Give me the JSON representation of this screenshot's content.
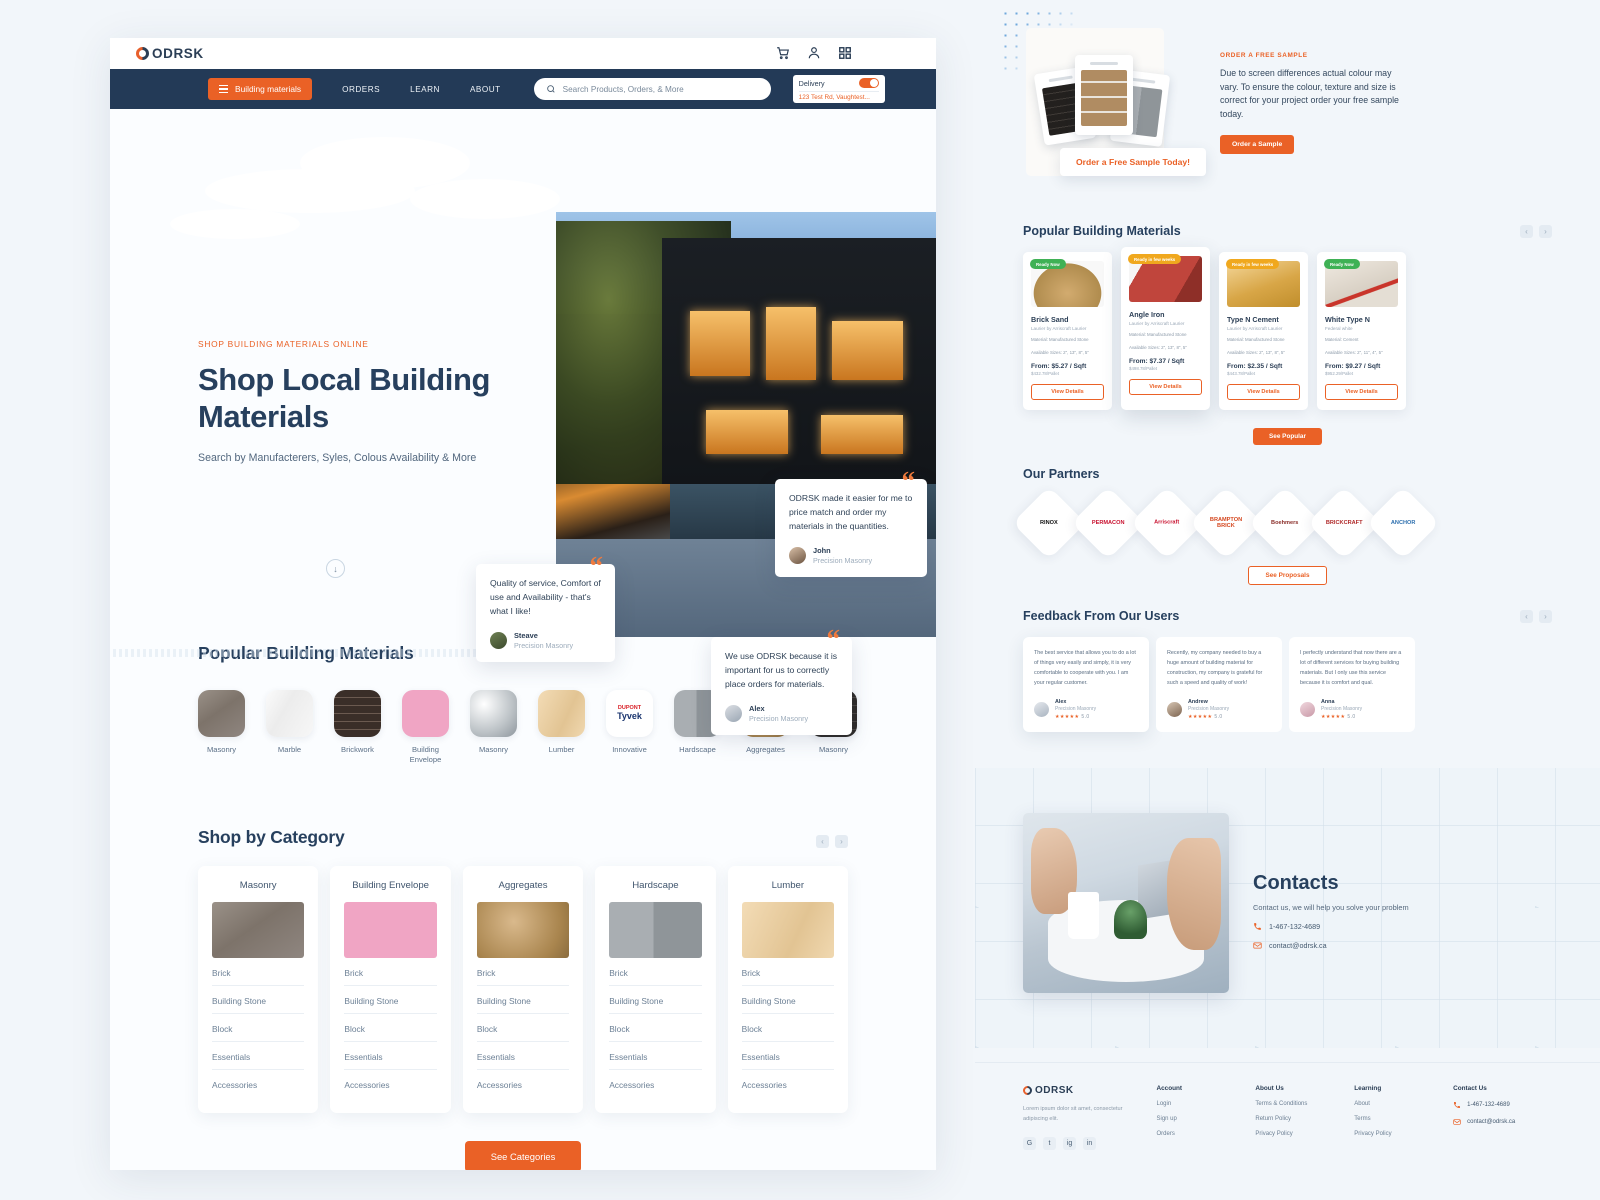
{
  "brand": {
    "name": "ODRSK"
  },
  "topbar": {
    "icons": [
      "cart-icon",
      "user-icon",
      "grid-icon"
    ]
  },
  "nav": {
    "category_button": "Building materials",
    "links": [
      "ORDERS",
      "LEARN",
      "ABOUT"
    ],
    "search_placeholder": "Search Products, Orders, & More",
    "delivery_label": "Delivery",
    "delivery_address": "123 Test Rd, Vaughtest...",
    "delivery_toggle_on": true
  },
  "hero": {
    "eyebrow": "SHOP BUILDING MATERIALS ONLINE",
    "title": "Shop Local Building Materials",
    "subtitle": "Search by Manufacterers, Syles, Colous Availability & More",
    "scroll_icon": "↓",
    "testimonials": [
      {
        "id": "steave",
        "text": "Quality of service, Comfort of use and Availability - that's what I like!",
        "name": "Steave",
        "company": "Precision Masonry"
      },
      {
        "id": "john",
        "text": "ODRSK made it easier for me to price match and order my materials in the quantities.",
        "name": "John",
        "company": "Precision Masonry"
      },
      {
        "id": "alex",
        "text": "We use ODRSK because it is important for us to correctly place orders for materials.",
        "name": "Alex",
        "company": "Precision Masonry"
      }
    ]
  },
  "popular_materials": {
    "title": "Popular Building Materials",
    "items": [
      {
        "label": "Masonry"
      },
      {
        "label": "Marble"
      },
      {
        "label": "Brickwork"
      },
      {
        "label": "Building Envelope"
      },
      {
        "label": "Masonry"
      },
      {
        "label": "Lumber"
      },
      {
        "label": "Innovative"
      },
      {
        "label": "Hardscape"
      },
      {
        "label": "Aggregates"
      },
      {
        "label": "Masonry"
      }
    ],
    "tyvek_brand": "Tyvek",
    "tyvek_sup": "DUPONT"
  },
  "shop_by_category": {
    "title": "Shop by Category",
    "prev_icon": "‹",
    "next_icon": "›",
    "cta": "See Categories",
    "links": [
      "Brick",
      "Building Stone",
      "Block",
      "Essentials",
      "Accessories"
    ],
    "cards": [
      {
        "title": "Masonry"
      },
      {
        "title": "Building Envelope"
      },
      {
        "title": "Aggregates"
      },
      {
        "title": "Hardscape"
      },
      {
        "title": "Lumber"
      }
    ]
  },
  "sample": {
    "badge": "Order a Free Sample Today!",
    "eyebrow": "ORDER A FREE SAMPLE",
    "body": "Due to screen differences actual colour may vary. To ensure the colour, texture and size is correct for your project order your free sample today.",
    "cta": "Order a Sample"
  },
  "products": {
    "title": "Popular Building Materials",
    "prev_icon": "‹",
    "next_icon": "›",
    "cta": "See Popular",
    "view_details": "View Details",
    "items": [
      {
        "badge": "Ready Now",
        "badge_color": "green",
        "name": "Brick Sand",
        "sub": "Laurier by Arriscraft Laurier",
        "material": "Material: Manufactured Stone",
        "sizes": "Available Sizes: 2\", 13\", 8\", 5\"",
        "price": "From: $5.27 / Sqft",
        "pallet": "$432.78/Pallet"
      },
      {
        "badge": "Ready in few weeks",
        "badge_color": "yellow",
        "name": "Angle Iron",
        "sub": "Laurier by Arriscraft Laurier",
        "material": "Material: Manufactured Stone",
        "sizes": "Available Sizes: 2\", 13\", 8\", 5\"",
        "price": "From: $7.37 / Sqft",
        "pallet": "$498.78/Pallet"
      },
      {
        "badge": "Ready in few weeks",
        "badge_color": "yellow",
        "name": "Type N Cement",
        "sub": "Laurier by Arriscraft Laurier",
        "material": "Material: Manufactured Stone",
        "sizes": "Available Sizes: 2\", 13\", 8\", 5\"",
        "price": "From: $2.35 / Sqft",
        "pallet": "$443.78/Pallet"
      },
      {
        "badge": "Ready Now",
        "badge_color": "green",
        "name": "White Type N",
        "sub": "Federal white",
        "material": "Material: Cement",
        "sizes": "Available Sizes: 2\", 11\", 4\", 5\"",
        "price": "From: $9.27 / Sqft",
        "pallet": "$952.29/Pallet"
      }
    ]
  },
  "partners": {
    "title": "Our Partners",
    "cta": "See Proposals",
    "logos": [
      {
        "name": "RINOX",
        "color": "#111111"
      },
      {
        "name": "PERMACON",
        "color": "#c8102e"
      },
      {
        "name": "Arriscraft",
        "color": "#c8102e"
      },
      {
        "name": "BRAMPTON BRICK",
        "color": "#d4471f"
      },
      {
        "name": "Boehmers",
        "color": "#8b2f2a"
      },
      {
        "name": "BRICKCRAFT",
        "color": "#b02a2a"
      },
      {
        "name": "ANCHOR",
        "color": "#2d6fae"
      }
    ]
  },
  "feedback": {
    "title": "Feedback From Our Users",
    "prev_icon": "‹",
    "next_icon": "›",
    "cards": [
      {
        "text": "The best service that allows you to do a lot of things very easily and simply, it is very comfortable to cooperate with you. I am your regular customer.",
        "name": "Alex",
        "company": "Precision Masonry",
        "stars": "★★★★★",
        "rating": "5.0"
      },
      {
        "text": "Recently, my company needed to buy a huge amount of building material for construction, my company is grateful for such a speed and quality of work!",
        "name": "Andrew",
        "company": "Precision Masonry",
        "stars": "★★★★★",
        "rating": "5.0"
      },
      {
        "text": "I perfectly understand that now there are a lot of different services for buying building materials. But I only use this service because it is comfort and qual.",
        "name": "Anna",
        "company": "Precision Masonry",
        "stars": "★★★★★",
        "rating": "5.0"
      }
    ]
  },
  "contacts": {
    "title": "Contacts",
    "subtitle": "Contact us, we will help you solve your problem",
    "phone": "1-467-132-4689",
    "email": "contact@odrsk.ca"
  },
  "footer": {
    "brand": "ODRSK",
    "description": "Lorem ipsum dolor sit amet, consectetur adipiscing elit.",
    "social": [
      "G",
      "t",
      "ig",
      "in"
    ],
    "columns": [
      {
        "heading": "Account",
        "links": [
          "Login",
          "Sign up",
          "Orders"
        ]
      },
      {
        "heading": "About Us",
        "links": [
          "Terms & Conditions",
          "Return Policy",
          "Privacy Policy"
        ]
      },
      {
        "heading": "Learning",
        "links": [
          "About",
          "Terms",
          "Privacy Policy"
        ]
      }
    ],
    "contact_heading": "Contact Us",
    "phone": "1-467-132-4689",
    "email": "contact@odrsk.ca"
  },
  "colors": {
    "accent": "#ea6126",
    "navy": "#233a57",
    "ink": "#27405e",
    "bg": "#f2f6fa"
  }
}
